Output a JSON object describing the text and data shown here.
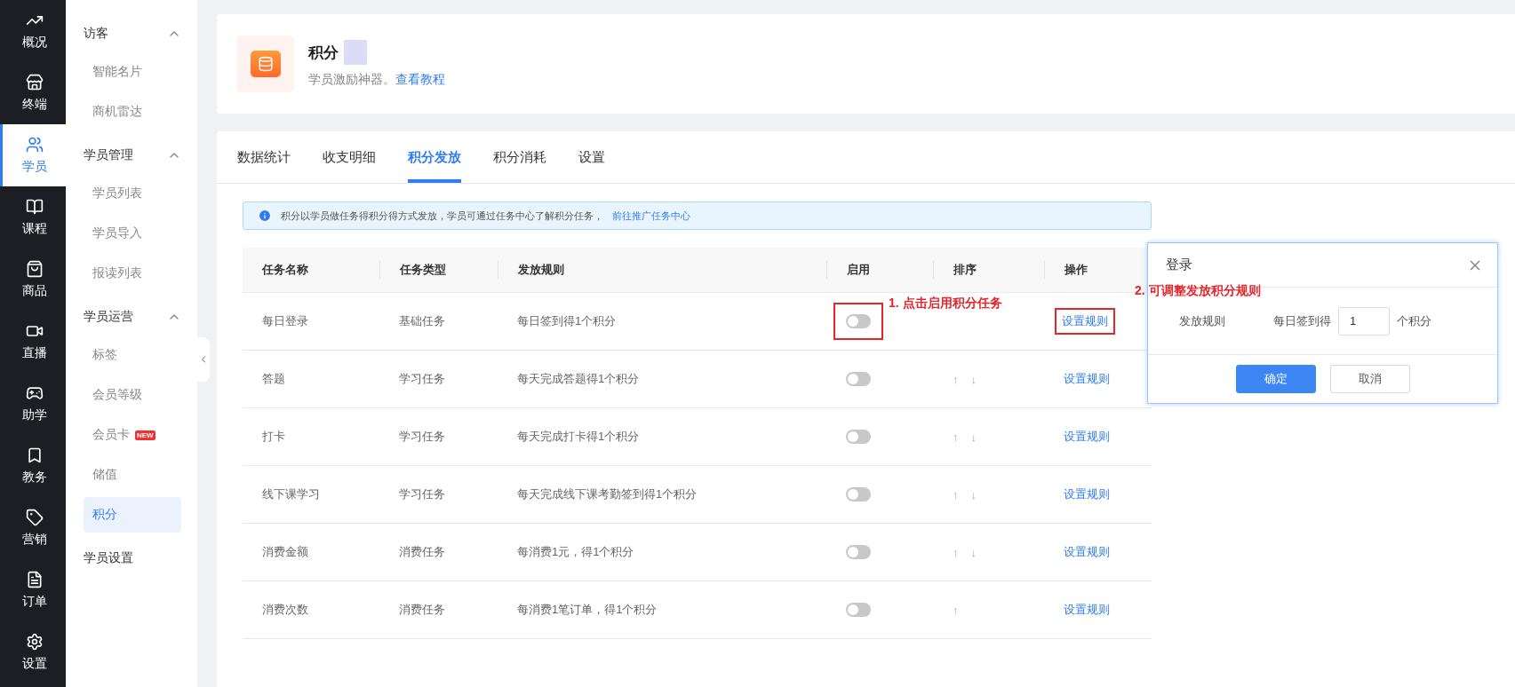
{
  "rail": [
    {
      "label": "概况",
      "selected": false
    },
    {
      "label": "终端",
      "selected": false
    },
    {
      "label": "学员",
      "selected": true
    },
    {
      "label": "课程",
      "selected": false
    },
    {
      "label": "商品",
      "selected": false
    },
    {
      "label": "直播",
      "selected": false
    },
    {
      "label": "助学",
      "selected": false
    },
    {
      "label": "教务",
      "selected": false
    },
    {
      "label": "营销",
      "selected": false
    },
    {
      "label": "订单",
      "selected": false
    },
    {
      "label": "设置",
      "selected": false
    }
  ],
  "sidebar": {
    "groups": [
      {
        "label": "访客",
        "expanded": true,
        "children": [
          {
            "label": "智能名片",
            "selected": false
          },
          {
            "label": "商机雷达",
            "selected": false
          }
        ]
      },
      {
        "label": "学员管理",
        "expanded": true,
        "children": [
          {
            "label": "学员列表",
            "selected": false
          },
          {
            "label": "学员导入",
            "selected": false
          },
          {
            "label": "报读列表",
            "selected": false
          }
        ]
      },
      {
        "label": "学员运营",
        "expanded": true,
        "children": [
          {
            "label": "标签",
            "selected": false
          },
          {
            "label": "会员等级",
            "selected": false
          },
          {
            "label": "会员卡",
            "selected": false,
            "badge": "NEW"
          },
          {
            "label": "储值",
            "selected": false
          },
          {
            "label": "积分",
            "selected": true
          }
        ]
      },
      {
        "label": "学员设置"
      }
    ]
  },
  "header": {
    "title": "积分",
    "subtitle": "学员激励神器。",
    "link": "查看教程"
  },
  "tabs": [
    {
      "label": "数据统计",
      "selected": false
    },
    {
      "label": "收支明细",
      "selected": false
    },
    {
      "label": "积分发放",
      "selected": true
    },
    {
      "label": "积分消耗",
      "selected": false
    },
    {
      "label": "设置",
      "selected": false
    }
  ],
  "notice": {
    "text": "积分以学员做任务得积分得方式发放，学员可通过任务中心了解积分任务，",
    "link": "前往推广任务中心"
  },
  "table": {
    "columns": [
      "任务名称",
      "任务类型",
      "发放规则",
      "启用",
      "排序",
      "操作"
    ],
    "rows": [
      {
        "name": "每日登录",
        "type": "基础任务",
        "rule": "每日签到得1个积分",
        "on": false,
        "sort": [],
        "action": "设置规则",
        "toggle_callout": "1. 点击启用积分任务",
        "action_callout": "2. 可调整发放积分规则"
      },
      {
        "name": "答题",
        "type": "学习任务",
        "rule": "每天完成答题得1个积分",
        "on": false,
        "sort": [
          "↑",
          "↓"
        ],
        "action": "设置规则"
      },
      {
        "name": "打卡",
        "type": "学习任务",
        "rule": "每天完成打卡得1个积分",
        "on": false,
        "sort": [
          "↑",
          "↓"
        ],
        "action": "设置规则"
      },
      {
        "name": "线下课学习",
        "type": "学习任务",
        "rule": "每天完成线下课考勤签到得1个积分",
        "on": false,
        "sort": [
          "↑",
          "↓"
        ],
        "action": "设置规则"
      },
      {
        "name": "消费金额",
        "type": "消费任务",
        "rule": "每消费1元，得1个积分",
        "on": false,
        "sort": [
          "↑",
          "↓"
        ],
        "action": "设置规则"
      },
      {
        "name": "消费次数",
        "type": "消费任务",
        "rule": "每消费1笔订单，得1个积分",
        "on": false,
        "sort": [
          "↑"
        ],
        "action": "设置规则"
      }
    ]
  },
  "popup": {
    "title": "登录",
    "label": "发放规则",
    "prefix": "每日签到得",
    "value": "1",
    "suffix": "个积分",
    "buttons": [
      {
        "label": "确定",
        "kind": "primary"
      },
      {
        "label": "取消",
        "kind": "default"
      }
    ]
  }
}
